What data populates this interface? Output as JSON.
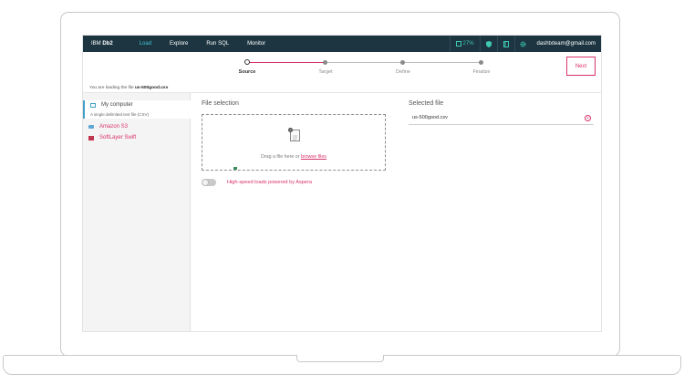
{
  "topnav": {
    "brand_prefix": "IBM",
    "brand_name": "Db2",
    "items": [
      {
        "label": "Load",
        "active": true
      },
      {
        "label": "Explore",
        "active": false
      },
      {
        "label": "Run SQL",
        "active": false
      },
      {
        "label": "Monitor",
        "active": false
      }
    ],
    "usage": "27%",
    "user": "dashtxteam@gmail.com",
    "icons": [
      "storage-usage-icon",
      "shield-icon",
      "notebook-icon",
      "gear-icon"
    ]
  },
  "steps": {
    "items": [
      "Source",
      "Target",
      "Define",
      "Finalize"
    ],
    "current_index": 0
  },
  "next_button": "Next",
  "loading_note": {
    "prefix": "You are loading the file",
    "file": "us-500good.csv"
  },
  "sidebar": {
    "active": {
      "title": "My computer",
      "subtitle": "A single delimited text file (CSV)"
    },
    "links": [
      "Amazon S3",
      "SoftLayer Swift"
    ]
  },
  "file_selection": {
    "title": "File selection",
    "drop_text": "Drag a file here or",
    "browse_link": "browse files"
  },
  "aspera": {
    "label": "High-speed loads powered by Aspera",
    "enabled": false
  },
  "selected_file": {
    "title": "Selected file",
    "value": "us-500good.csv"
  },
  "colors": {
    "nav_bg": "#1c3541",
    "accent_pink": "#d8336a",
    "accent_teal": "#3ec9b0",
    "active_nav": "#43c3d1"
  }
}
